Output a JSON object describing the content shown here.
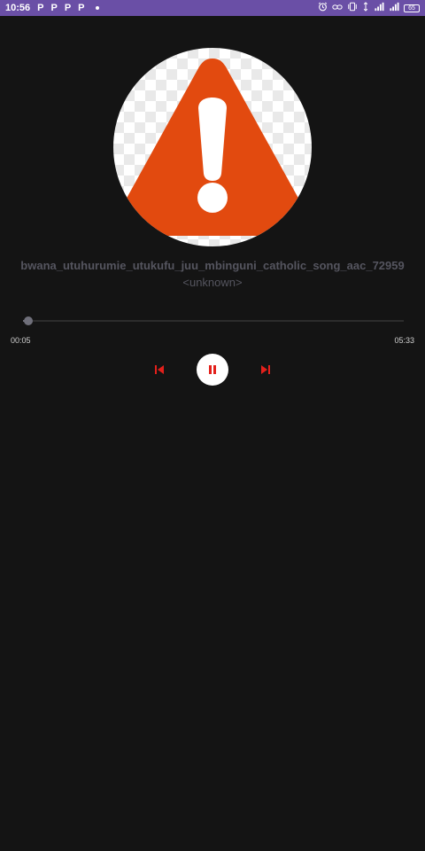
{
  "status_bar": {
    "time": "10:56",
    "notification_icons": [
      "P",
      "P",
      "P",
      "P"
    ],
    "battery_level": "65",
    "icons": [
      "alarm-icon",
      "link-icon",
      "vibrate-icon",
      "hotspot-icon",
      "signal-icon",
      "signal-icon",
      "battery-icon"
    ],
    "background_color": "#6a4fa6"
  },
  "album_art": {
    "icon": "warning-icon",
    "warning_color": "#e24a0f"
  },
  "track": {
    "title": "bwana_utuhurumie_utukufu_juu_mbinguni_catholic_song_aac_72959",
    "artist": "<unknown>"
  },
  "seekbar": {
    "current_time": "00:05",
    "total_time": "05:33",
    "progress": 0.015
  },
  "controls": {
    "prev_icon": "skip-previous-icon",
    "play_pause_icon": "pause-icon",
    "next_icon": "skip-next-icon",
    "accent_color": "#e3201b"
  }
}
